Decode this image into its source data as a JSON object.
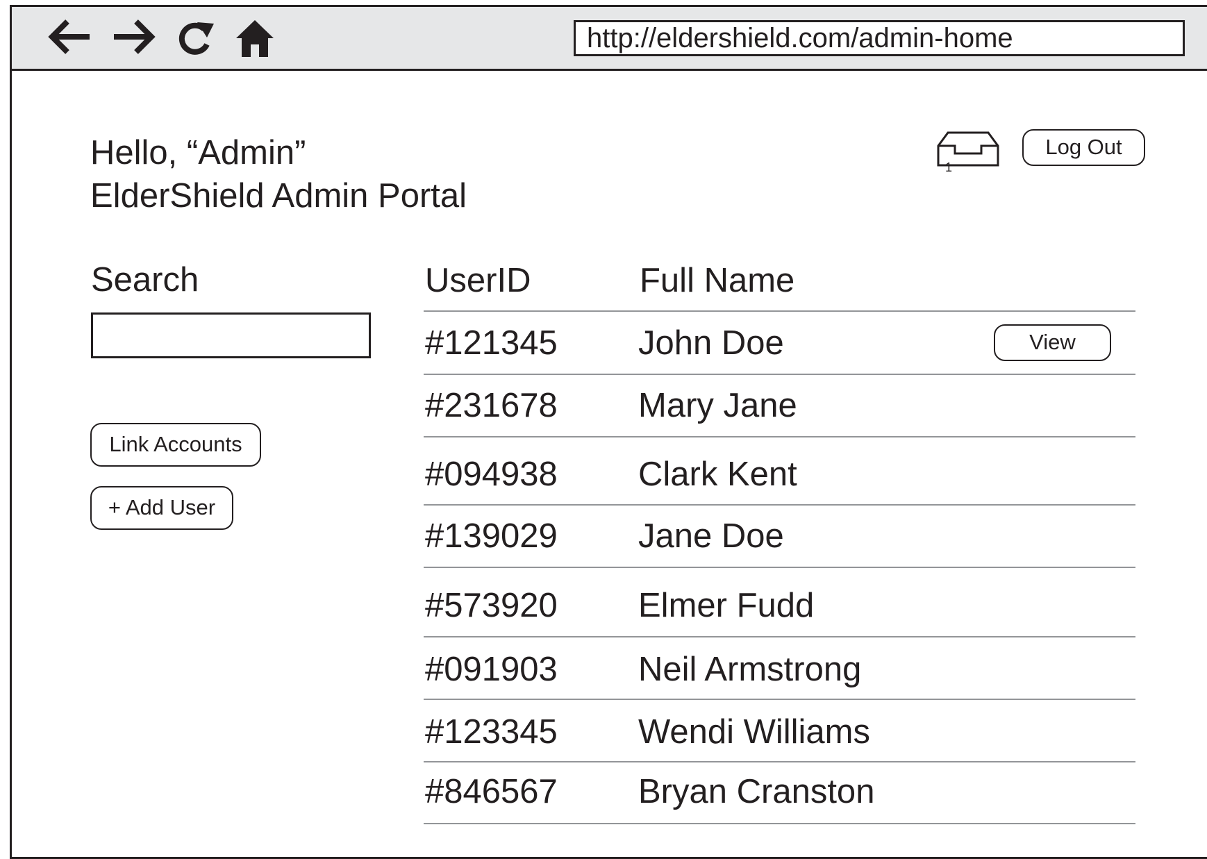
{
  "browser": {
    "back_icon": "arrow-left-icon",
    "forward_icon": "arrow-right-icon",
    "reload_icon": "reload-icon",
    "home_icon": "home-icon",
    "url": "http://eldershield.com/admin-home"
  },
  "header": {
    "greeting": "Hello, “Admin”",
    "portal_title": "ElderShield Admin Portal",
    "inbox_icon": "inbox-icon",
    "inbox_count": "1",
    "logout_label": "Log Out"
  },
  "sidebar": {
    "search_label": "Search",
    "search_value": "",
    "link_accounts_label": "Link Accounts",
    "add_user_label": "+ Add User"
  },
  "table": {
    "headers": {
      "user_id": "UserID",
      "full_name": "Full Name"
    },
    "view_label": "View",
    "rows": [
      {
        "id": "#121345",
        "name": "John Doe",
        "has_view": true
      },
      {
        "id": "#231678",
        "name": "Mary Jane",
        "has_view": false
      },
      {
        "id": "#094938",
        "name": "Clark Kent",
        "has_view": false
      },
      {
        "id": "#139029",
        "name": "Jane Doe",
        "has_view": false
      },
      {
        "id": "#573920",
        "name": "Elmer Fudd",
        "has_view": false
      },
      {
        "id": "#091903",
        "name": "Neil Armstrong",
        "has_view": false
      },
      {
        "id": "#123345",
        "name": "Wendi Williams",
        "has_view": false
      },
      {
        "id": "#846567",
        "name": "Bryan Cranston",
        "has_view": false
      }
    ]
  }
}
